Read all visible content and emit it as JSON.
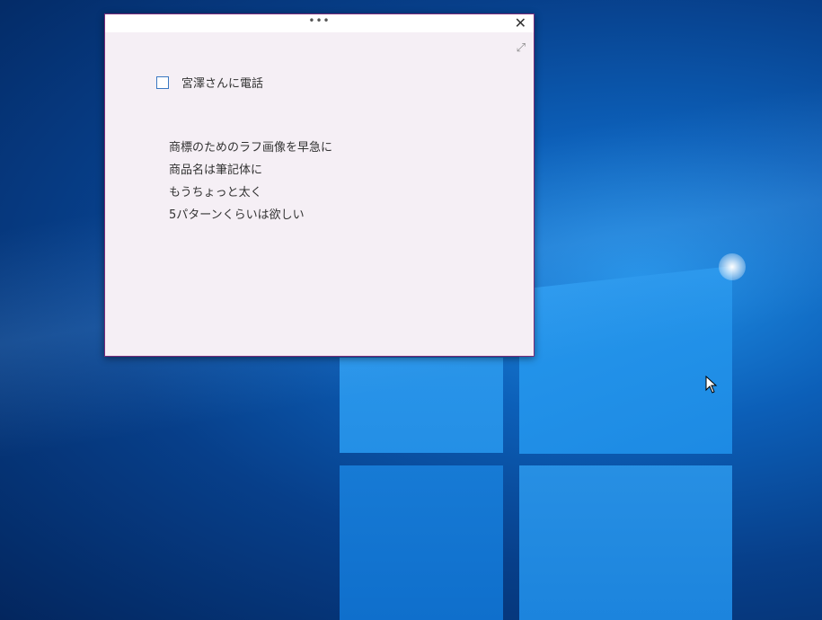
{
  "note": {
    "menu_icon": "more-dots-icon",
    "menu_text": "•••",
    "close_icon": "close-icon",
    "close_text": "✕",
    "expand_icon": "expand-icon",
    "expand_text": "⤢",
    "todo": {
      "label": "宮澤さんに電話",
      "checked": false
    },
    "lines": [
      "商標のためのラフ画像を早急に",
      "商品名は筆記体に",
      "もうちょっと太く",
      "5パターンくらいは欲しい"
    ]
  },
  "colors": {
    "accent": "#7b2d7b",
    "note_bg": "#f5eff5",
    "checkbox": "#3b78c2"
  }
}
